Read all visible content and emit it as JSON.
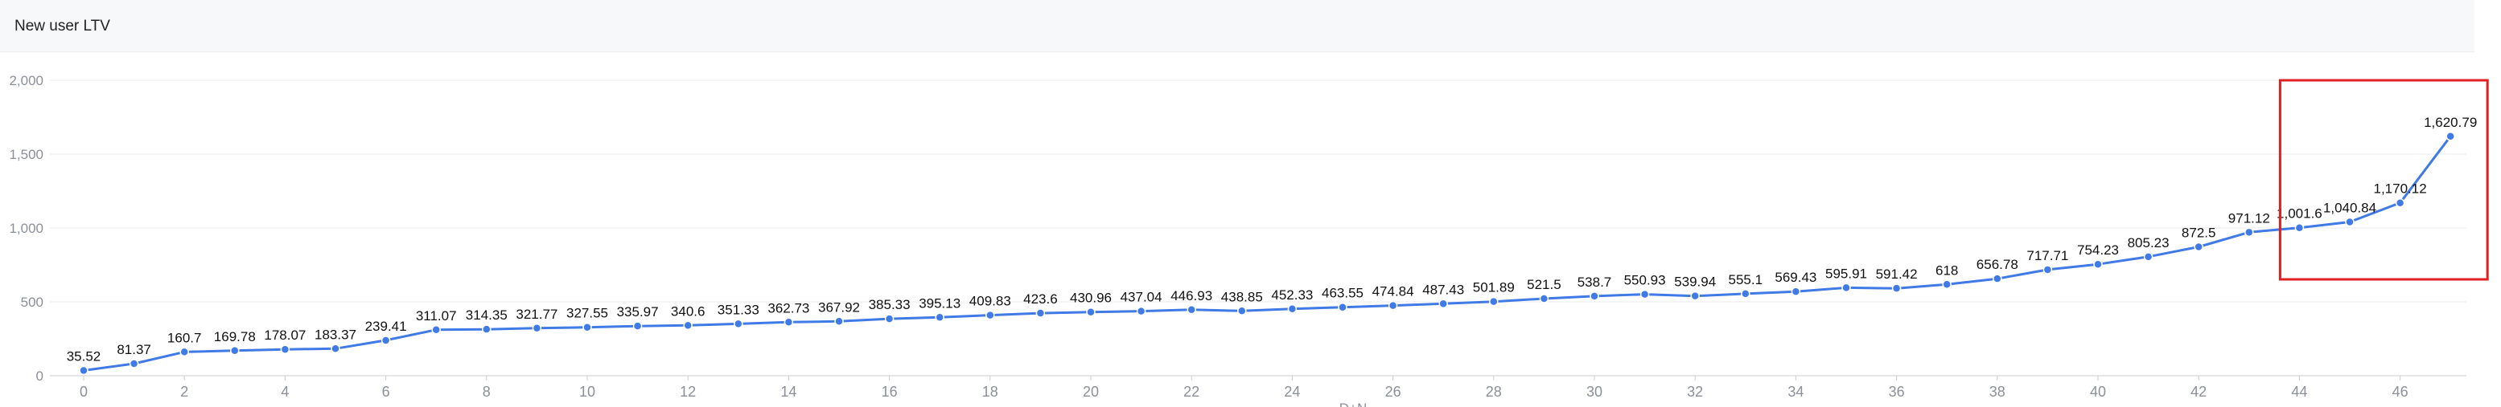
{
  "header": {
    "title": "New user LTV"
  },
  "chart_data": {
    "type": "line",
    "title": "New user LTV",
    "xlabel": "D+N",
    "ylabel": "",
    "ylim": [
      0,
      2000
    ],
    "yticks": [
      0,
      500,
      1000,
      1500,
      2000
    ],
    "ytick_labels": [
      "0",
      "500",
      "1,000",
      "1,500",
      "2,000"
    ],
    "xticks": [
      0,
      2,
      4,
      6,
      8,
      10,
      12,
      14,
      16,
      18,
      20,
      22,
      24,
      26,
      28,
      30,
      32,
      34,
      36,
      38,
      40,
      42,
      44,
      46
    ],
    "x": [
      0,
      1,
      2,
      3,
      4,
      5,
      6,
      7,
      8,
      9,
      10,
      11,
      12,
      13,
      14,
      15,
      16,
      17,
      18,
      19,
      20,
      21,
      22,
      23,
      24,
      25,
      26,
      27,
      28,
      29,
      30,
      31,
      32,
      33,
      34,
      35,
      36,
      37,
      38,
      39,
      40,
      41,
      42,
      43,
      44,
      45,
      46,
      47
    ],
    "values": [
      35.52,
      81.37,
      160.7,
      169.78,
      178.07,
      183.37,
      239.41,
      311.07,
      314.35,
      321.77,
      327.55,
      335.97,
      340.6,
      351.33,
      362.73,
      367.92,
      385.33,
      395.13,
      409.83,
      423.6,
      430.96,
      437.04,
      446.93,
      438.85,
      452.33,
      463.55,
      474.84,
      487.43,
      501.89,
      521.5,
      538.7,
      550.93,
      539.94,
      555.1,
      569.43,
      595.91,
      591.42,
      618,
      656.78,
      717.71,
      754.23,
      805.23,
      872.5,
      971.12,
      1001.6,
      1040.84,
      1170.12,
      1620.79
    ],
    "labels": [
      "35.52",
      "81.37",
      "160.7",
      "169.78",
      "178.07",
      "183.37",
      "239.41",
      "311.07",
      "314.35",
      "321.77",
      "327.55",
      "335.97",
      "340.6",
      "351.33",
      "362.73",
      "367.92",
      "385.33",
      "395.13",
      "409.83",
      "423.6",
      "430.96",
      "437.04",
      "446.93",
      "438.85",
      "452.33",
      "463.55",
      "474.84",
      "487.43",
      "501.89",
      "521.5",
      "538.7",
      "550.93",
      "539.94",
      "555.1",
      "569.43",
      "595.91",
      "591.42",
      "618",
      "656.78",
      "717.71",
      "754.23",
      "805.23",
      "872.5",
      "971.12",
      "1,001.6",
      "1,040.84",
      "1,170.12",
      "1,620.79"
    ],
    "grid": true,
    "line_color": "#3f7ae6",
    "highlight_color": "#e02020",
    "highlight_x_range": [
      44,
      47
    ]
  }
}
